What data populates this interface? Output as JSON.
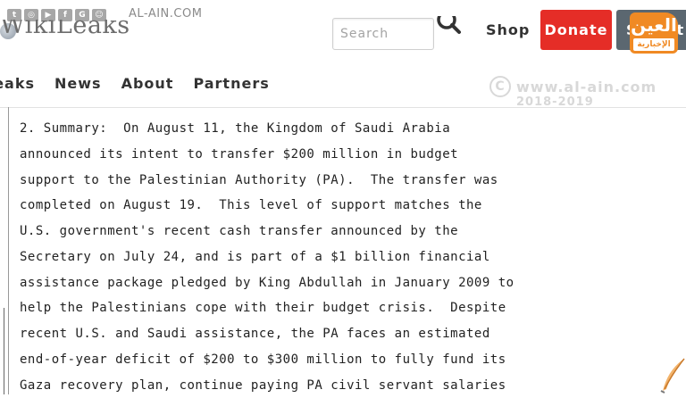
{
  "header": {
    "social_icons": [
      "twitter-icon",
      "instagram-icon",
      "youtube-icon",
      "facebook-icon",
      "googleplus-icon",
      "snapchat-icon"
    ],
    "site_host": "AL-AIN.COM",
    "logo_text": "WikiLeaks",
    "search": {
      "placeholder": "Search"
    },
    "shop_label": "Shop",
    "donate_label": "Donate",
    "gray_button_label": "Submit",
    "badge": {
      "line1": "العين",
      "line2": "الإخبارية"
    }
  },
  "nav": {
    "items": [
      "Leaks",
      "News",
      "About",
      "Partners"
    ]
  },
  "watermark": {
    "line1": "www.al-ain.com",
    "line2": "2018-2019"
  },
  "document": {
    "lines": [
      "2. Summary:  On August 11, the Kingdom of Saudi Arabia",
      "announced its intent to transfer $200 million in budget",
      "support to the Palestinian Authority (PA).  The transfer was",
      "completed on August 19.  This level of support matches the",
      "U.S. government's recent cash transfer announced by the",
      "Secretary on July 24, and is part of a $1 billion financial",
      "assistance package pledged by King Abdullah in January 2009 to",
      "help the Palestinians cope with their budget crisis.  Despite",
      "recent U.S. and Saudi assistance, the PA faces an estimated",
      "end-of-year deficit of $200 to $300 million to fully fund its",
      "Gaza recovery plan, continue paying PA civil servant salaries"
    ]
  },
  "colors": {
    "donate": "#e52d27",
    "gray_button": "#5b6770",
    "badge": "#f08a24"
  }
}
